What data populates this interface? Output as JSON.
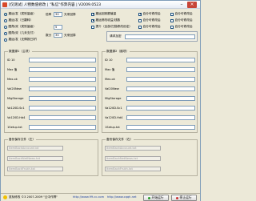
{
  "window": {
    "title": "[仅测试] 人物数值修改 | \"私信\"作弊内容 | V2009.0523",
    "min_label": "–",
    "close_label": "×"
  },
  "options_left": [
    {
      "label": "搬运/发（类别量级）",
      "checked": true
    },
    {
      "label": "搬运/发（已翻转）",
      "checked": false
    },
    {
      "label": "图角/双（类别量级）",
      "checked": false
    },
    {
      "label": "图角/双（几未支付）",
      "checked": false
    },
    {
      "label": "搬运/发（无情报已好）",
      "checked": false
    }
  ],
  "numeric": {
    "a_label": "倍率",
    "a_value": "30",
    "a_unit": "天来回算",
    "b_value": "5",
    "c_label": "数分",
    "c_value": "30",
    "c_unit": "天来回算"
  },
  "options_mid": [
    {
      "label": "搬运回到额值量",
      "checked": true
    },
    {
      "label": "搬运修改收益/钱数",
      "checked": true
    },
    {
      "label": "提介（全部/扫描修改设定）",
      "checked": false
    }
  ],
  "options_right": [
    {
      "label": "自分可修改后",
      "checked": true
    },
    {
      "label": "自分可修改后",
      "checked": false
    },
    {
      "label": "自分可修改后",
      "checked": false
    },
    {
      "label": "自分可修改后",
      "checked": false
    },
    {
      "label": "自分可修改后",
      "checked": false
    },
    {
      "label": "自分可修改后",
      "checked": false
    }
  ],
  "send": {
    "label": "请求加密",
    "value": ""
  },
  "left_group": {
    "title": "数据源1（主项）",
    "rows": [
      "ID 10",
      "Max 值",
      "Mex.ok",
      "Val20New",
      "MigStorage",
      "Va120D.Sc1",
      "Va120D.Hd4",
      "1Setup.txt"
    ]
  },
  "right_group": {
    "title": "数据源2（副项）",
    "rows": [
      "ID 10",
      "Max 值",
      "Mex.ok",
      "Val20New",
      "MigStorage",
      "Va120D.Sc1",
      "Va120D.Hd4",
      "1Setup.txt"
    ]
  },
  "left_file_group": {
    "title": "备份保存文件（左）",
    "files": [
      "ItemBackAccount.txt",
      "ItemBackNetNews.txt",
      "ItemBackFrukh.txt"
    ]
  },
  "right_file_group": {
    "title": "备份保存文件（右）",
    "files": [
      "ItemBackAccount.txt",
      "ItemBackNetNews.txt",
      "ItemBackFrukh.txt"
    ]
  },
  "status": {
    "text1": "鼠标修改 ©3 2007-2009 \"云中作弊\"",
    "link": "http://www.99.cc.com",
    "text2": "http://www.cqqh.net",
    "start_label": "开始运行",
    "stop_label": "停止运行"
  },
  "colors": {
    "accent": "#1c5180",
    "close": "#c74538",
    "window_bg": "#ece9d8"
  }
}
